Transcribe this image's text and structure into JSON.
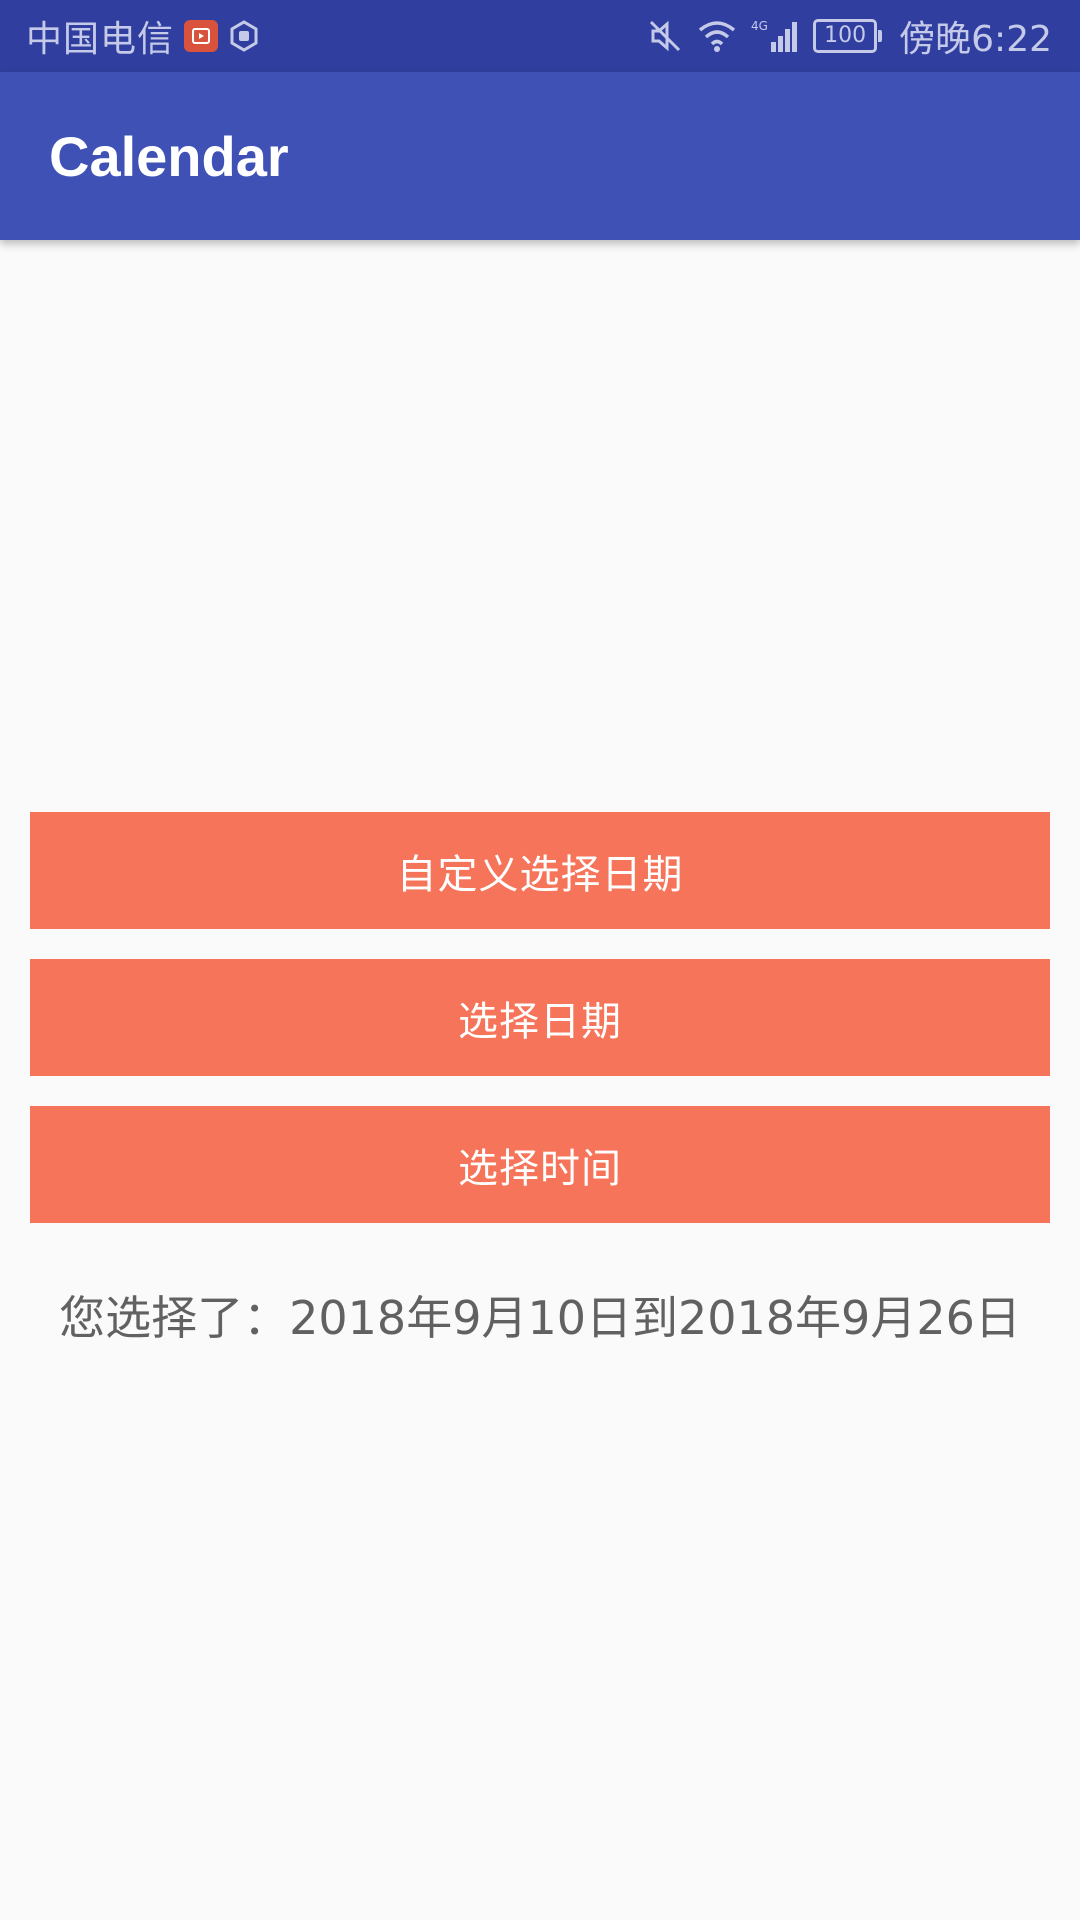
{
  "status_bar": {
    "carrier": "中国电信",
    "battery": "100",
    "time": "傍晚6:22",
    "network": "4G"
  },
  "app_bar": {
    "title": "Calendar"
  },
  "buttons": {
    "custom_select_date": "自定义选择日期",
    "select_date": "选择日期",
    "select_time": "选择时间"
  },
  "result": {
    "text": "您选择了：2018年9月10日到2018年9月26日"
  },
  "colors": {
    "status_bar": "#303f9f",
    "app_bar": "#3f51b5",
    "button": "#f67459",
    "background": "#fafafa"
  }
}
